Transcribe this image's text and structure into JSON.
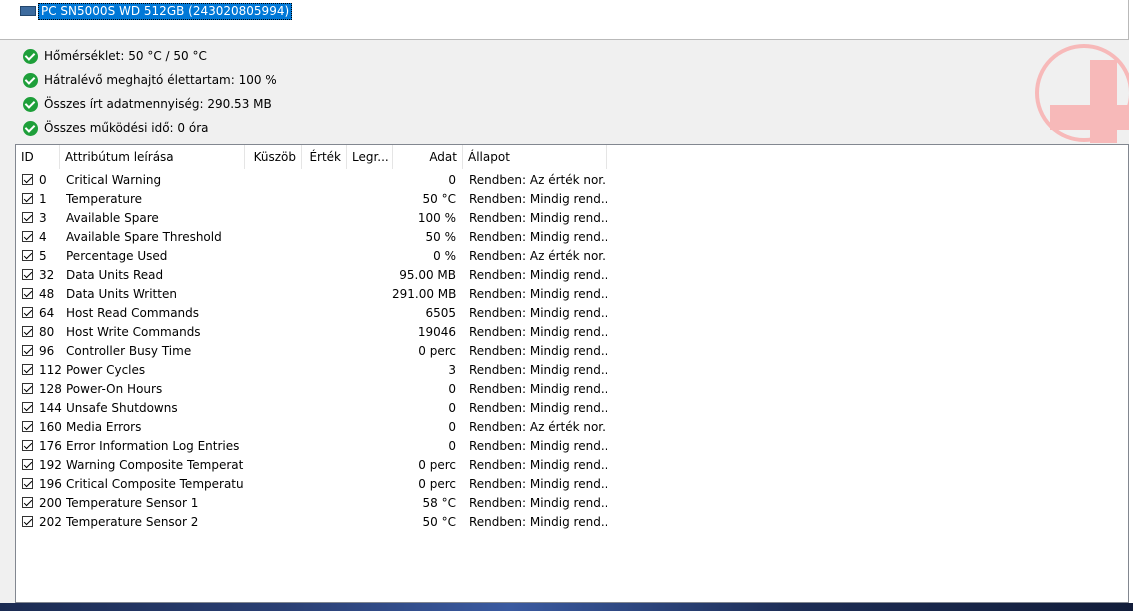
{
  "drive": {
    "label": "PC SN5000S WD 512GB (243020805994)",
    "icon": "drive-icon"
  },
  "status": [
    {
      "text": "Hőmérséklet: 50 °C / 50 °C",
      "icon": "ok-check-icon"
    },
    {
      "text": "Hátralévő meghajtó élettartam: 100 %",
      "icon": "ok-check-icon"
    },
    {
      "text": "Összes írt adatmennyiség: 290.53 MB",
      "icon": "ok-check-icon"
    },
    {
      "text": "Összes működési idő: 0 óra",
      "icon": "ok-check-icon"
    }
  ],
  "colors": {
    "selection": "#0078d7",
    "ok_green": "#1e9f3a",
    "health_logo": "#f7b9b9"
  },
  "table": {
    "headers": {
      "id": "ID",
      "description": "Attribútum leírása",
      "threshold": "Küszöb",
      "value": "Érték",
      "worst": "Legr...",
      "data": "Adat",
      "status": "Állapot"
    },
    "rows": [
      {
        "id": "0",
        "description": "Critical Warning",
        "data": "0",
        "status": "Rendben: Az érték nor..."
      },
      {
        "id": "1",
        "description": "Temperature",
        "data": "50 °C",
        "status": "Rendben: Mindig rend..."
      },
      {
        "id": "3",
        "description": "Available Spare",
        "data": "100 %",
        "status": "Rendben: Mindig rend..."
      },
      {
        "id": "4",
        "description": "Available Spare Threshold",
        "data": "50 %",
        "status": "Rendben: Mindig rend..."
      },
      {
        "id": "5",
        "description": "Percentage Used",
        "data": "0 %",
        "status": "Rendben: Az érték nor..."
      },
      {
        "id": "32",
        "description": "Data Units Read",
        "data": "95.00 MB",
        "status": "Rendben: Mindig rend..."
      },
      {
        "id": "48",
        "description": "Data Units Written",
        "data": "291.00 MB",
        "status": "Rendben: Mindig rend..."
      },
      {
        "id": "64",
        "description": "Host Read Commands",
        "data": "6505",
        "status": "Rendben: Mindig rend..."
      },
      {
        "id": "80",
        "description": "Host Write Commands",
        "data": "19046",
        "status": "Rendben: Mindig rend..."
      },
      {
        "id": "96",
        "description": "Controller Busy Time",
        "data": "0 perc",
        "status": "Rendben: Mindig rend..."
      },
      {
        "id": "112",
        "description": "Power Cycles",
        "data": "3",
        "status": "Rendben: Mindig rend..."
      },
      {
        "id": "128",
        "description": "Power-On Hours",
        "data": "0",
        "status": "Rendben: Mindig rend..."
      },
      {
        "id": "144",
        "description": "Unsafe Shutdowns",
        "data": "0",
        "status": "Rendben: Mindig rend..."
      },
      {
        "id": "160",
        "description": "Media Errors",
        "data": "0",
        "status": "Rendben: Az érték nor..."
      },
      {
        "id": "176",
        "description": "Error Information Log Entries",
        "data": "0",
        "status": "Rendben: Mindig rend..."
      },
      {
        "id": "192",
        "description": "Warning Composite Temperat...",
        "data": "0 perc",
        "status": "Rendben: Mindig rend..."
      },
      {
        "id": "196",
        "description": "Critical Composite Temperatur...",
        "data": "0 perc",
        "status": "Rendben: Mindig rend..."
      },
      {
        "id": "200",
        "description": "Temperature Sensor 1",
        "data": "58 °C",
        "status": "Rendben: Mindig rend..."
      },
      {
        "id": "202",
        "description": "Temperature Sensor 2",
        "data": "50 °C",
        "status": "Rendben: Mindig rend..."
      }
    ]
  }
}
